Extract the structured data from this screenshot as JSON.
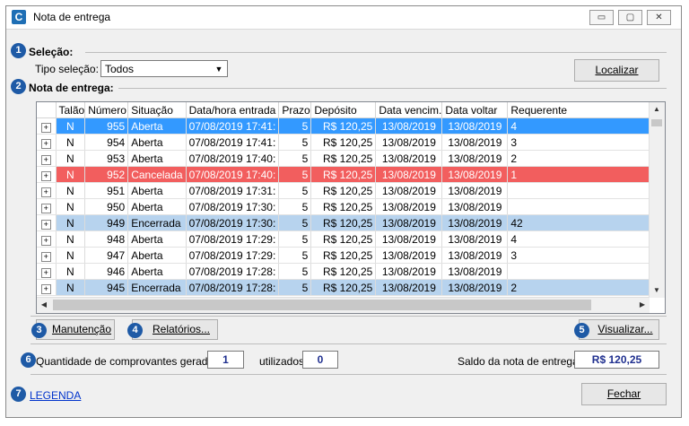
{
  "window": {
    "icon_letter": "C",
    "title": "Nota de entrega",
    "controls": {
      "minimize": "▭",
      "maximize": "▢",
      "close": "✕"
    }
  },
  "badges": [
    "1",
    "2",
    "3",
    "4",
    "5",
    "6",
    "7"
  ],
  "selecao": {
    "title": "Seleção:",
    "tipo_label": "Tipo seleção:",
    "tipo_value": "Todos",
    "localizar": "Localizar"
  },
  "nota": {
    "title": "Nota de entrega:",
    "columns": [
      "Talão",
      "Número",
      "Situação",
      "Data/hora entrada",
      "Prazo",
      "Depósito",
      "Data vencim.",
      "Data voltar",
      "Requerente"
    ],
    "rows": [
      {
        "talao": "N",
        "numero": "955",
        "situacao": "Aberta",
        "entrada": "07/08/2019 17:41:",
        "prazo": "5",
        "deposito": "R$ 120,25",
        "vencim": "13/08/2019",
        "voltar": "13/08/2019",
        "requerente": "4",
        "state": "sel"
      },
      {
        "talao": "N",
        "numero": "954",
        "situacao": "Aberta",
        "entrada": "07/08/2019 17:41:",
        "prazo": "5",
        "deposito": "R$ 120,25",
        "vencim": "13/08/2019",
        "voltar": "13/08/2019",
        "requerente": "3",
        "state": ""
      },
      {
        "talao": "N",
        "numero": "953",
        "situacao": "Aberta",
        "entrada": "07/08/2019 17:40:",
        "prazo": "5",
        "deposito": "R$ 120,25",
        "vencim": "13/08/2019",
        "voltar": "13/08/2019",
        "requerente": "2",
        "state": ""
      },
      {
        "talao": "N",
        "numero": "952",
        "situacao": "Cancelada",
        "entrada": "07/08/2019 17:40:",
        "prazo": "5",
        "deposito": "R$ 120,25",
        "vencim": "13/08/2019",
        "voltar": "13/08/2019",
        "requerente": "1",
        "state": "cancel"
      },
      {
        "talao": "N",
        "numero": "951",
        "situacao": "Aberta",
        "entrada": "07/08/2019 17:31:",
        "prazo": "5",
        "deposito": "R$ 120,25",
        "vencim": "13/08/2019",
        "voltar": "13/08/2019",
        "requerente": "",
        "state": ""
      },
      {
        "talao": "N",
        "numero": "950",
        "situacao": "Aberta",
        "entrada": "07/08/2019 17:30:",
        "prazo": "5",
        "deposito": "R$ 120,25",
        "vencim": "13/08/2019",
        "voltar": "13/08/2019",
        "requerente": "",
        "state": ""
      },
      {
        "talao": "N",
        "numero": "949",
        "situacao": "Encerrada",
        "entrada": "07/08/2019 17:30:",
        "prazo": "5",
        "deposito": "R$ 120,25",
        "vencim": "13/08/2019",
        "voltar": "13/08/2019",
        "requerente": "42",
        "state": "closed"
      },
      {
        "talao": "N",
        "numero": "948",
        "situacao": "Aberta",
        "entrada": "07/08/2019 17:29:",
        "prazo": "5",
        "deposito": "R$ 120,25",
        "vencim": "13/08/2019",
        "voltar": "13/08/2019",
        "requerente": "4",
        "state": ""
      },
      {
        "talao": "N",
        "numero": "947",
        "situacao": "Aberta",
        "entrada": "07/08/2019 17:29:",
        "prazo": "5",
        "deposito": "R$ 120,25",
        "vencim": "13/08/2019",
        "voltar": "13/08/2019",
        "requerente": "3",
        "state": ""
      },
      {
        "talao": "N",
        "numero": "946",
        "situacao": "Aberta",
        "entrada": "07/08/2019 17:28:",
        "prazo": "5",
        "deposito": "R$ 120,25",
        "vencim": "13/08/2019",
        "voltar": "13/08/2019",
        "requerente": "",
        "state": ""
      },
      {
        "talao": "N",
        "numero": "945",
        "situacao": "Encerrada",
        "entrada": "07/08/2019 17:28:",
        "prazo": "5",
        "deposito": "R$ 120,25",
        "vencim": "13/08/2019",
        "voltar": "13/08/2019",
        "requerente": "2",
        "state": "closed"
      }
    ],
    "expander": "+"
  },
  "buttons": {
    "manutencao": "Manutenção",
    "relatorios": "Relatórios...",
    "visualizar": "Visualizar...",
    "fechar": "Fechar"
  },
  "footer": {
    "qtd_label": "Quantidade de comprovantes gerados:",
    "qtd_value": "1",
    "utilizados_label": "utilizados:",
    "utilizados_value": "0",
    "saldo_label": "Saldo da nota de entrega:",
    "saldo_value": "R$ 120,25",
    "legenda": "LEGENDA"
  },
  "colors": {
    "selected_row": "#3399ff",
    "cancelled_row": "#f25e5e",
    "closed_row": "#b7d3ee",
    "badge": "#1e5aa6"
  }
}
